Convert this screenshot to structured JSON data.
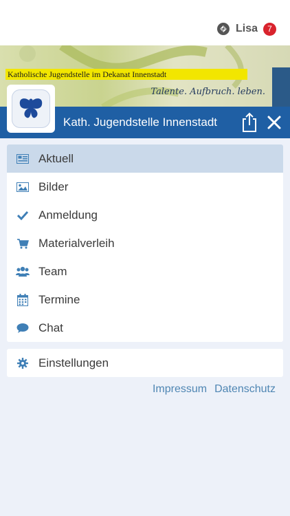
{
  "header": {
    "user_name": "Lisa",
    "notification_count": "7"
  },
  "banner": {
    "organization_line": "Katholische Jugendstelle im Dekanat Innenstadt",
    "slogan": "Talente. Aufbruch. leben."
  },
  "navbar": {
    "title": "Kath. Jugendstelle Innenstadt"
  },
  "menu": {
    "items": [
      {
        "label": "Aktuell",
        "icon": "newspaper-icon",
        "active": true
      },
      {
        "label": "Bilder",
        "icon": "image-icon",
        "active": false
      },
      {
        "label": "Anmeldung",
        "icon": "check-icon",
        "active": false
      },
      {
        "label": "Materialverleih",
        "icon": "cart-icon",
        "active": false
      },
      {
        "label": "Team",
        "icon": "users-icon",
        "active": false
      },
      {
        "label": "Termine",
        "icon": "calendar-icon",
        "active": false
      },
      {
        "label": "Chat",
        "icon": "chat-bubble-icon",
        "active": false
      }
    ],
    "settings_label": "Einstellungen"
  },
  "footer": {
    "impressum": "Impressum",
    "datenschutz": "Datenschutz"
  },
  "colors": {
    "navbar": "#1f5fa4",
    "icon": "#3f7fb6",
    "active_row": "#cad9ea",
    "badge": "#d9232d",
    "background": "#edf1f9"
  }
}
